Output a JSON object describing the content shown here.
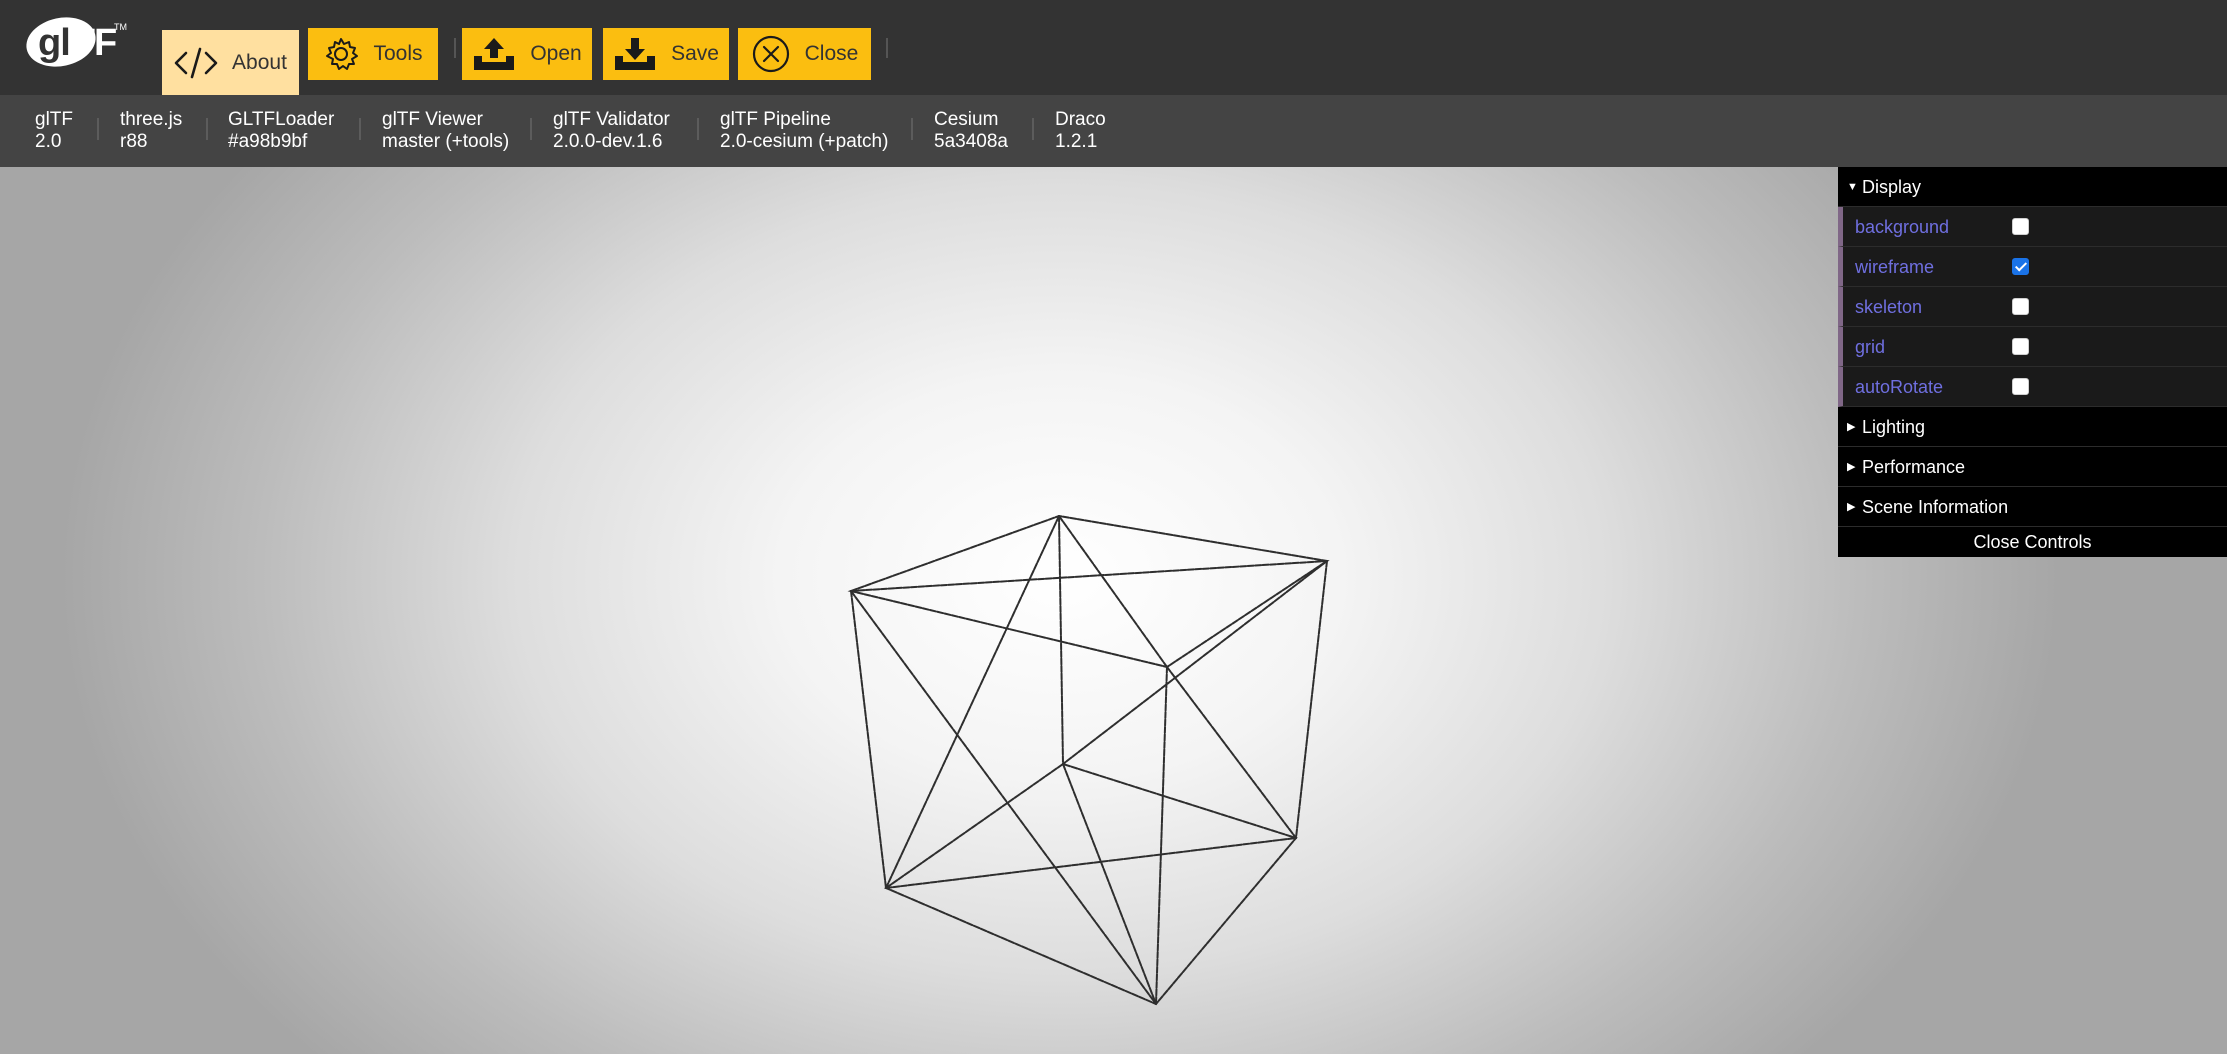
{
  "logo": {
    "gl": "gl",
    "tf": "TF",
    "tm": "TM"
  },
  "toolbar": {
    "buttons": [
      {
        "label": "About",
        "icon": "code-icon"
      },
      {
        "label": "Tools",
        "icon": "gear-icon"
      },
      {
        "label": "Open",
        "icon": "upload-icon"
      },
      {
        "label": "Save",
        "icon": "download-icon"
      },
      {
        "label": "Close",
        "icon": "close-circle-icon"
      }
    ],
    "active": "About",
    "accent": "#fbbe10",
    "active_color": "#ffe0a0"
  },
  "versions": [
    {
      "name": "glTF",
      "value": "2.0"
    },
    {
      "name": "three.js",
      "value": "r88"
    },
    {
      "name": "GLTFLoader",
      "value": "#a98b9bf"
    },
    {
      "name": "glTF Viewer",
      "value": "master (+tools)"
    },
    {
      "name": "glTF Validator",
      "value": "2.0.0-dev.1.6"
    },
    {
      "name": "glTF Pipeline",
      "value": "2.0-cesium (+patch)"
    },
    {
      "name": "Cesium",
      "value": "5a3408a"
    },
    {
      "name": "Draco",
      "value": "1.2.1"
    }
  ],
  "controls": {
    "display_folder": "Display",
    "display_items": [
      {
        "label": "background",
        "checked": false
      },
      {
        "label": "wireframe",
        "checked": true
      },
      {
        "label": "skeleton",
        "checked": false
      },
      {
        "label": "grid",
        "checked": false
      },
      {
        "label": "autoRotate",
        "checked": false
      }
    ],
    "folders": [
      "Lighting",
      "Performance",
      "Scene Information"
    ],
    "close_label": "Close Controls"
  }
}
